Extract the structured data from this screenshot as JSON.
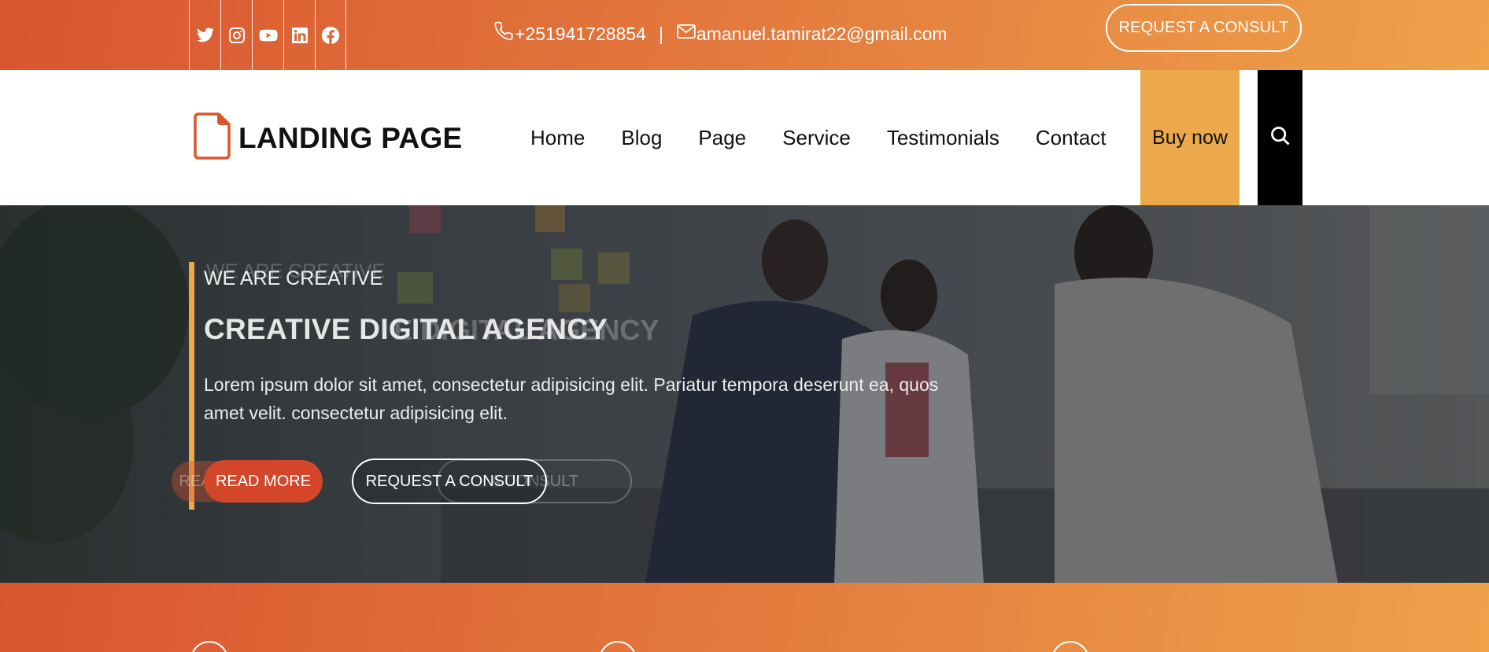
{
  "colors": {
    "accent_orange": "#d9552f",
    "accent_gold": "#eca94c",
    "search_bg": "#000000",
    "button_red": "#d4462a"
  },
  "topbar": {
    "social_icons": [
      "twitter-icon",
      "instagram-icon",
      "youtube-icon",
      "linkedin-icon",
      "facebook-icon"
    ],
    "phone": "+251941728854",
    "separator": "|",
    "email": "amanuel.tamirat22@gmail.com",
    "consult_label": "REQUEST A CONSULT"
  },
  "navbar": {
    "logo_icon": "file-icon",
    "brand": "LANDING PAGE",
    "menu": [
      "Home",
      "Blog",
      "Page",
      "Service",
      "Testimonials",
      "Contact"
    ],
    "buy_label": "Buy now",
    "search_icon": "search-icon"
  },
  "hero": {
    "tagline": "WE ARE CREATIVE",
    "title": "CREATIVE DIGITAL AGENCY",
    "ghost_title": "E DIGITAL AGENCY",
    "ghost_read": "READ MORE",
    "ghost_consult": "A CONSULT",
    "description": "Lorem ipsum dolor sit amet, consectetur adipisicing elit. Pariatur tempora deserunt ea, quos amet velit. consectetur adipisicing elit.",
    "read_more_label": "READ MORE",
    "consult_label": "REQUEST A CONSULT"
  }
}
